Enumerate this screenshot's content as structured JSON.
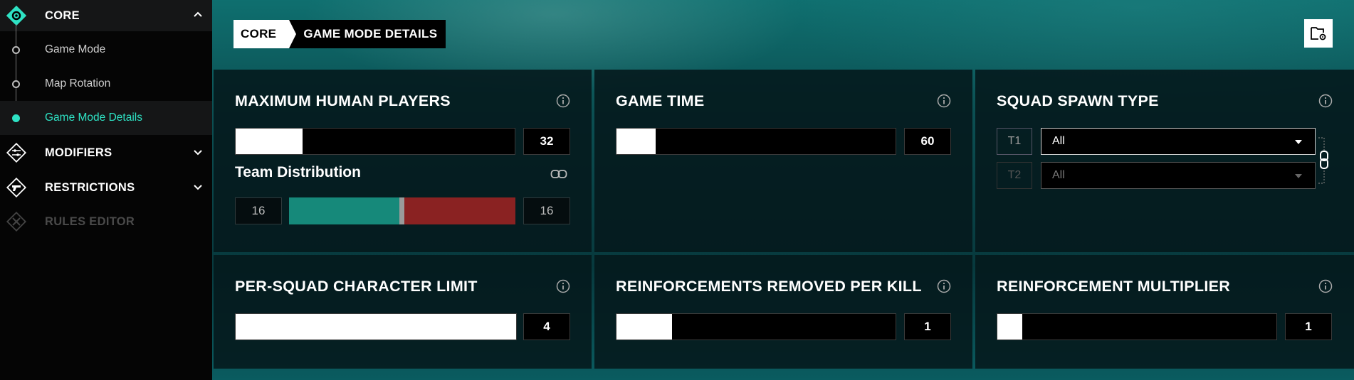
{
  "sidebar": {
    "core": {
      "label": "CORE"
    },
    "items": [
      {
        "label": "Game Mode"
      },
      {
        "label": "Map Rotation"
      },
      {
        "label": "Game Mode Details"
      }
    ],
    "modifiers": {
      "label": "MODIFIERS"
    },
    "restrictions": {
      "label": "RESTRICTIONS"
    },
    "rules_editor": {
      "label": "RULES EDITOR"
    }
  },
  "breadcrumb": {
    "root": "CORE",
    "current": "GAME MODE DETAILS"
  },
  "panels": {
    "max_players": {
      "title": "MAXIMUM HUMAN PLAYERS",
      "value": "32",
      "fill_fraction": 0.24
    },
    "team_distribution": {
      "title": "Team Distribution",
      "team1": "16",
      "team2": "16",
      "split_fraction": 0.5
    },
    "game_time": {
      "title": "GAME TIME",
      "value": "60",
      "fill_fraction": 0.14
    },
    "squad_spawn": {
      "title": "SQUAD SPAWN TYPE",
      "t1_label": "T1",
      "t1_value": "All",
      "t2_label": "T2",
      "t2_value": "All"
    },
    "squad_limit": {
      "title": "PER-SQUAD CHARACTER LIMIT",
      "value": "4",
      "fill_fraction": 1.0
    },
    "reinf_removed": {
      "title": "REINFORCEMENTS REMOVED PER KILL",
      "value": "1",
      "fill_fraction": 0.2
    },
    "reinf_mult": {
      "title": "REINFORCEMENT MULTIPLIER",
      "value": "1",
      "fill_fraction": 0.09
    }
  },
  "colors": {
    "accent": "#2ee2c4",
    "team1": "#16897a",
    "team2": "#8a2222"
  }
}
